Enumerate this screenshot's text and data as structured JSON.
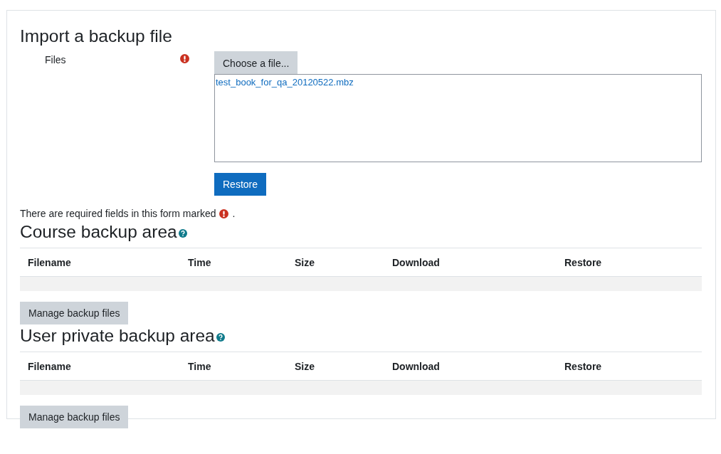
{
  "title": "Import a backup file",
  "files_field": {
    "label": "Files",
    "required": true,
    "button": "Choose a file...",
    "file": "test_book_for_qa_20120522.mbz"
  },
  "restore_button": "Restore",
  "required_note": {
    "text": "There are required fields in this form marked",
    "end": "."
  },
  "areas": [
    {
      "title": "Course backup area",
      "help": true,
      "columns": [
        "Filename",
        "Time",
        "Size",
        "Download",
        "Restore"
      ],
      "button": "Manage backup files"
    },
    {
      "title": "User private backup area",
      "help": true,
      "columns": [
        "Filename",
        "Time",
        "Size",
        "Download",
        "Restore"
      ],
      "button": "Manage backup files"
    }
  ]
}
